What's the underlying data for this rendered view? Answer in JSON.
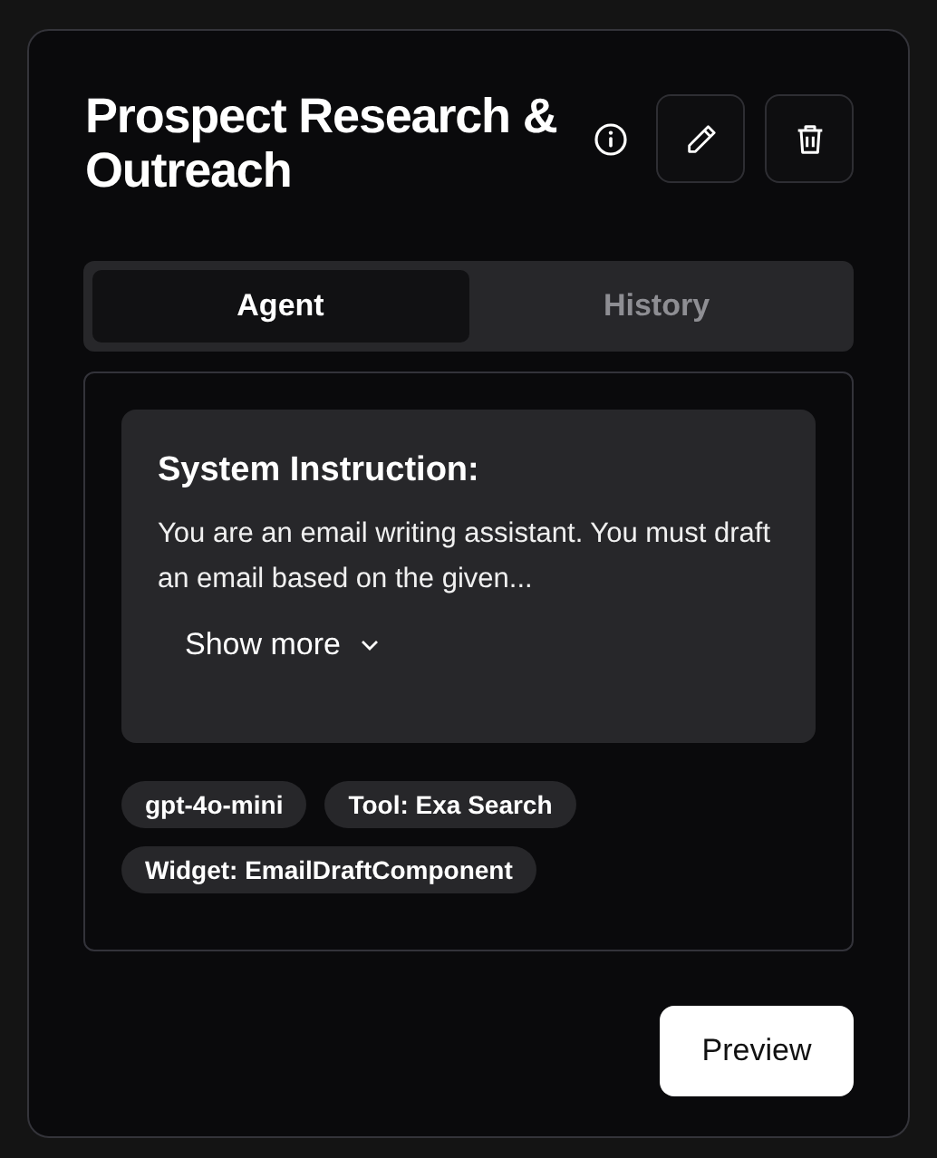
{
  "title": "Prospect Research & Outreach",
  "tabs": [
    {
      "label": "Agent",
      "selected": true
    },
    {
      "label": "History",
      "selected": false
    }
  ],
  "instruction": {
    "heading": "System Instruction:",
    "text": "You are an email writing assistant. You must draft an email based on the given...",
    "toggle": "Show more",
    "expanded": false
  },
  "tags": [
    "gpt-4o-mini",
    "Tool: Exa Search",
    "Widget: EmailDraftComponent"
  ],
  "preview_button": "Preview"
}
